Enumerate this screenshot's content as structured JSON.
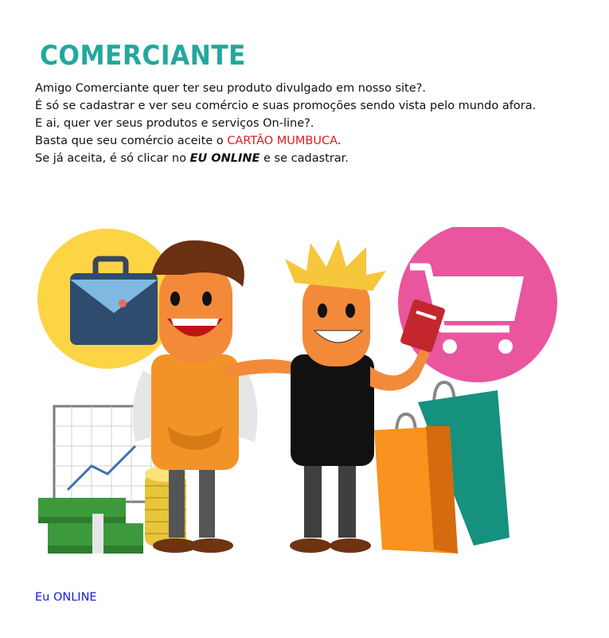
{
  "page": {
    "title": "COMERCIANTE",
    "title_color": "#23a89c"
  },
  "intro": {
    "line1": "Amigo Comerciante quer ter seu produto divulgado em nosso site?.",
    "line2": "É só se cadastrar e ver seu comércio e suas promoções sendo vista pelo mundo afora.",
    "line3": "E ai, quer ver seus produtos e serviços On-line?.",
    "line4_prefix": "Basta que seu comércio aceite o ",
    "line4_highlight": "CARTÃO MUMBUCA",
    "line4_suffix": ".",
    "line5_prefix": "Se já aceita, é só clicar no ",
    "line5_emphasis": "EU ONLINE",
    "line5_suffix": " e se cadastrar."
  },
  "illustration": {
    "icons": [
      "briefcase-icon",
      "shopping-cart-icon",
      "chart-icon",
      "money-stack-icon",
      "coin-stack-icon",
      "shopping-bag-icon",
      "credit-card-icon"
    ],
    "colors": {
      "yellow_circle": "#fcd444",
      "pink_circle": "#e9569e",
      "apron": "#f29327",
      "teal_bag": "#16907f",
      "orange_bag": "#f7931e",
      "money": "#3c9a3d",
      "shirt": "#111111"
    }
  },
  "footer": {
    "link_label": "Eu ONLINE",
    "link_color": "#1a1ad6"
  }
}
